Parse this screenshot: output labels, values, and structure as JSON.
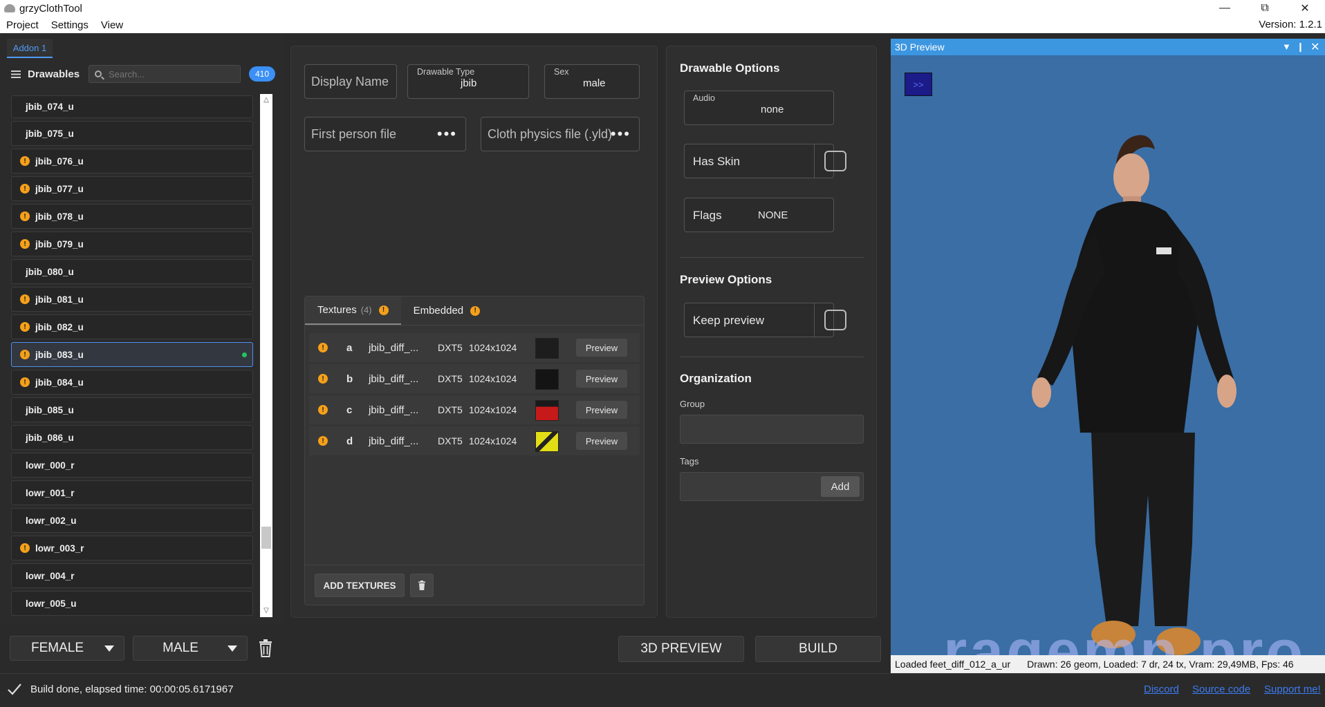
{
  "window": {
    "title": "grzyClothTool"
  },
  "menu": {
    "items": [
      "Project",
      "Settings",
      "View"
    ],
    "version": "Version: 1.2.1"
  },
  "left": {
    "addon_tab": "Addon 1",
    "drawables_label": "Drawables",
    "search_placeholder": "Search...",
    "count": "410",
    "items": [
      {
        "name": "jbib_074_u",
        "warn": false
      },
      {
        "name": "jbib_075_u",
        "warn": false
      },
      {
        "name": "jbib_076_u",
        "warn": true
      },
      {
        "name": "jbib_077_u",
        "warn": true
      },
      {
        "name": "jbib_078_u",
        "warn": true
      },
      {
        "name": "jbib_079_u",
        "warn": true
      },
      {
        "name": "jbib_080_u",
        "warn": false
      },
      {
        "name": "jbib_081_u",
        "warn": true
      },
      {
        "name": "jbib_082_u",
        "warn": true
      },
      {
        "name": "jbib_083_u",
        "warn": true,
        "selected": true
      },
      {
        "name": "jbib_084_u",
        "warn": true
      },
      {
        "name": "jbib_085_u",
        "warn": false
      },
      {
        "name": "jbib_086_u",
        "warn": false
      },
      {
        "name": "lowr_000_r",
        "warn": false
      },
      {
        "name": "lowr_001_r",
        "warn": false
      },
      {
        "name": "lowr_002_u",
        "warn": false
      },
      {
        "name": "lowr_003_r",
        "warn": true
      },
      {
        "name": "lowr_004_r",
        "warn": false
      },
      {
        "name": "lowr_005_u",
        "warn": false
      }
    ],
    "female_label": "FEMALE",
    "male_label": "MALE"
  },
  "details": {
    "display_name_placeholder": "Display Name",
    "drawable_type_label": "Drawable Type",
    "drawable_type_value": "jbib",
    "sex_label": "Sex",
    "sex_value": "male",
    "first_person_label": "First person file",
    "cloth_physics_label": "Cloth physics file (.yld)",
    "tab_textures": "Textures",
    "tab_textures_count": "(4)",
    "tab_embedded": "Embedded",
    "preview_label": "Preview",
    "textures": [
      {
        "letter": "a",
        "name": "jbib_diff_...",
        "format": "DXT5",
        "size": "1024x1024",
        "thumb": "#1d1d1d"
      },
      {
        "letter": "b",
        "name": "jbib_diff_...",
        "format": "DXT5",
        "size": "1024x1024",
        "thumb": "#141414"
      },
      {
        "letter": "c",
        "name": "jbib_diff_...",
        "format": "DXT5",
        "size": "1024x1024",
        "thumb": "#c61a1a"
      },
      {
        "letter": "d",
        "name": "jbib_diff_...",
        "format": "DXT5",
        "size": "1024x1024",
        "thumb": "#e3dd16"
      }
    ],
    "add_textures_label": "ADD TEXTURES"
  },
  "options": {
    "drawable_options_title": "Drawable Options",
    "audio_label": "Audio",
    "audio_value": "none",
    "has_skin_label": "Has Skin",
    "flags_label": "Flags",
    "flags_value": "NONE",
    "preview_options_title": "Preview Options",
    "keep_preview_label": "Keep preview",
    "organization_title": "Organization",
    "group_label": "Group",
    "tags_label": "Tags",
    "add_label": "Add"
  },
  "preview": {
    "title": "3D Preview",
    "expand_label": ">>",
    "watermark": "ragemp.pro",
    "status_left": "Loaded feet_diff_012_a_ur",
    "status_right": "Drawn: 26 geom, Loaded: 7 dr, 24 tx, Vram: 29,49MB, Fps: 46"
  },
  "buttons": {
    "preview_3d": "3D PREVIEW",
    "build": "BUILD"
  },
  "statusbar": {
    "message": "Build done, elapsed time: 00:00:05.6171967",
    "links": [
      "Discord",
      "Source code",
      "Support me!"
    ]
  },
  "colors": {
    "accent": "#3b8ff5",
    "warning": "#f5a01a",
    "active_dot": "#22c55e",
    "preview_bg": "#3a6ea5"
  }
}
